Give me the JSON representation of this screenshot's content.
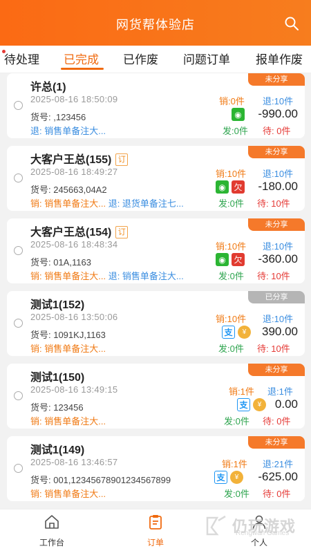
{
  "header": {
    "title": "网货帮体验店"
  },
  "tabs": [
    {
      "label": "待处理"
    },
    {
      "label": "已完成"
    },
    {
      "label": "已作废"
    },
    {
      "label": "问题订单"
    },
    {
      "label": "报单作废"
    }
  ],
  "orders": [
    {
      "customer": "许总(1)",
      "ding": "",
      "time": "2025-08-16 18:50:09",
      "huohao": "货号: ,123456",
      "remark1": "",
      "remark2": "退: 销售单备注大...",
      "badge": "未分享",
      "xiao": "销:0件",
      "tui": "退:10件",
      "amount": "-990.00",
      "fa": "发:0件",
      "dai": "待: 0件",
      "pay": [
        "wx"
      ]
    },
    {
      "customer": "大客户王总(155)",
      "ding": "订",
      "time": "2025-08-16 18:49:27",
      "huohao": "货号: 245663,04A2",
      "remark1": "销: 销售单备注大...",
      "remark2": "退: 退货单备注七...",
      "badge": "未分享",
      "xiao": "销:10件",
      "tui": "退:10件",
      "amount": "-180.00",
      "fa": "发:0件",
      "dai": "待: 10件",
      "pay": [
        "wx",
        "qian"
      ]
    },
    {
      "customer": "大客户王总(154)",
      "ding": "订",
      "time": "2025-08-16 18:48:34",
      "huohao": "货号: 01A,1163",
      "remark1": "销: 销售单备注大...",
      "remark2": "退: 销售单备注大...",
      "badge": "未分享",
      "xiao": "销:10件",
      "tui": "退:10件",
      "amount": "-360.00",
      "fa": "发:0件",
      "dai": "待: 10件",
      "pay": [
        "wx",
        "qian"
      ]
    },
    {
      "customer": "测试1(152)",
      "ding": "",
      "time": "2025-08-16 13:50:06",
      "huohao": "货号: 1091KJ,1163",
      "remark1": "销: 销售单备注大...",
      "remark2": "",
      "badge": "已分享",
      "xiao": "销:10件",
      "tui": "退:10件",
      "amount": "390.00",
      "fa": "发:0件",
      "dai": "待: 10件",
      "pay": [
        "zfb",
        "coin"
      ]
    },
    {
      "customer": "测试1(150)",
      "ding": "",
      "time": "2025-08-16 13:49:15",
      "huohao": "货号: 123456",
      "remark1": "销: 销售单备注大...",
      "remark2": "",
      "badge": "未分享",
      "xiao": "销:1件",
      "tui": "退:1件",
      "amount": "0.00",
      "fa": "发:0件",
      "dai": "待: 0件",
      "pay": [
        "zfb",
        "coin"
      ]
    },
    {
      "customer": "测试1(149)",
      "ding": "",
      "time": "2025-08-16 13:46:57",
      "huohao": "货号: 001,12345678901234567899",
      "remark1": "销: 销售单备注大...",
      "remark2": "",
      "badge": "未分享",
      "xiao": "销:1件",
      "tui": "退:21件",
      "amount": "-625.00",
      "fa": "发:0件",
      "dai": "待: 0件",
      "pay": [
        "zfb",
        "coin"
      ]
    }
  ],
  "pay_glyphs": {
    "wx": "◉",
    "qian": "欠",
    "zfb": "支",
    "coin": "¥"
  },
  "nav": [
    {
      "label": "工作台",
      "icon": "home-icon"
    },
    {
      "label": "订单",
      "icon": "order-icon"
    },
    {
      "label": "个人",
      "icon": "person-icon"
    }
  ],
  "watermark": {
    "text": "仍玩游戏",
    "sub": "Rengwan Games"
  },
  "colors": {
    "accent": "#f06a0f",
    "header": "#fb6a14",
    "badge": "#f5792a",
    "badge_shared": "#b5b5b5"
  }
}
